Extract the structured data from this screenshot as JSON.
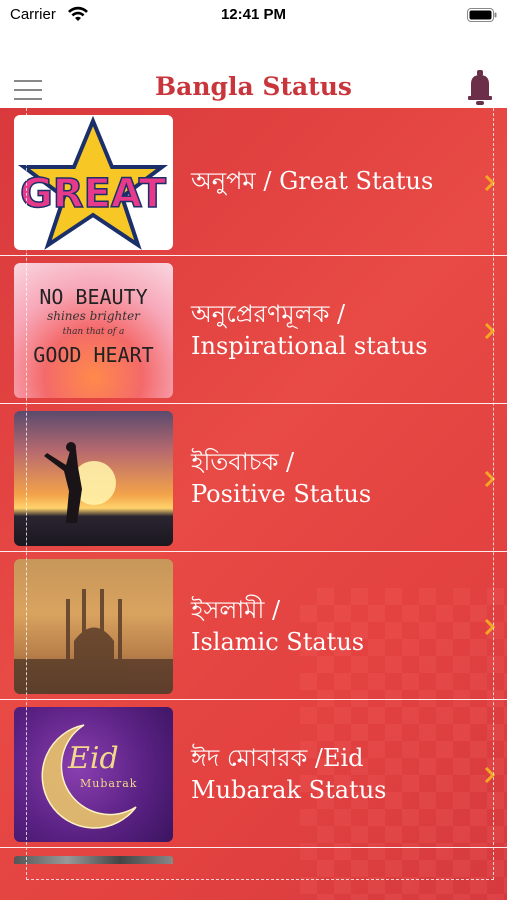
{
  "status_bar": {
    "carrier": "Carrier",
    "time": "12:41 PM"
  },
  "nav": {
    "title": "Bangla Status",
    "menu_icon": "hamburger-menu-icon",
    "bell_icon": "bell-icon"
  },
  "colors": {
    "accent": "#c8363b",
    "background_red": "#e34240"
  },
  "rows": [
    {
      "line1": "অনুপম / Great Status",
      "line2": "",
      "thumb": "great-star-sticker"
    },
    {
      "line1": "অনুপ্রেরণমূলক /",
      "line2": "Inspirational status",
      "thumb": "no-beauty-quote",
      "thumb_text": [
        "NO BEAUTY",
        "shines brighter",
        "than that of a",
        "GOOD HEART"
      ]
    },
    {
      "line1": "ইতিবাচক /",
      "line2": "Positive Status",
      "thumb": "sunset-silhouette"
    },
    {
      "line1": "ইসলামী /",
      "line2": "Islamic Status",
      "thumb": "mosque-sunset"
    },
    {
      "line1": "ঈদ মোবারক  /Eid",
      "line2": "Mubarak Status",
      "thumb": "eid-moon",
      "thumb_text": [
        "Eid",
        "Mubarak"
      ]
    }
  ],
  "great_sticker_text": "GREAT"
}
